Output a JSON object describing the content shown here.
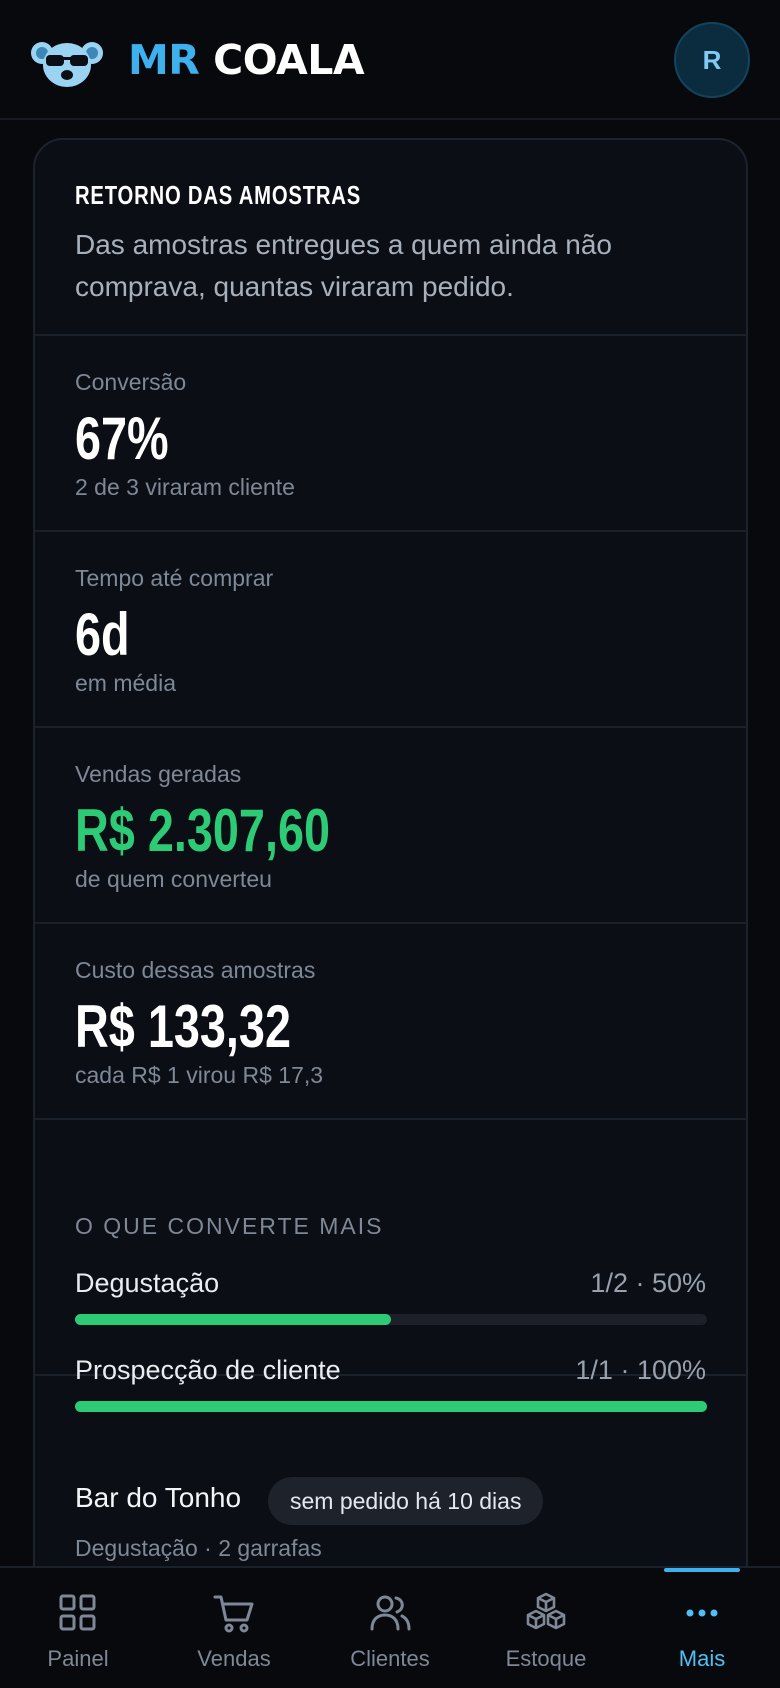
{
  "app": {
    "brand_mr": "MR",
    "brand_name": "COALA",
    "avatar_initial": "R"
  },
  "colors": {
    "accent": "#3fb0ee",
    "positive": "#2ecb77",
    "background": "#07090d",
    "card": "#0b0e14"
  },
  "card": {
    "title": "RETORNO DAS AMOSTRAS",
    "description": "Das amostras entregues a quem ainda não comprava, quantas viraram pedido.",
    "metrics": [
      {
        "label": "Conversão",
        "value": "67%",
        "sub": "2 de 3 viraram cliente"
      },
      {
        "label": "Tempo até comprar",
        "value": "6d",
        "sub": "em média"
      },
      {
        "label": "Vendas geradas",
        "value": "R$ 2.307,60",
        "sub": "de quem converteu"
      },
      {
        "label": "Custo dessas amostras",
        "value": "R$ 133,32",
        "sub": "cada R$ 1 virou R$ 17,3"
      }
    ],
    "conversion": {
      "title": "O QUE CONVERTE MAIS",
      "rows": [
        {
          "label": "Degustação",
          "value": "1/2 · 50%",
          "fraction": 0.5
        },
        {
          "label": "Prospecção de cliente",
          "value": "1/1 · 100%",
          "fraction": 1.0
        }
      ]
    },
    "item": {
      "name": "Bar do Tonho",
      "badge": "sem pedido há 10 dias",
      "sub": "Degustação · 2 garrafas"
    }
  },
  "tabs": [
    {
      "label": "Painel",
      "icon": "dashboard-icon"
    },
    {
      "label": "Vendas",
      "icon": "cart-icon"
    },
    {
      "label": "Clientes",
      "icon": "users-icon"
    },
    {
      "label": "Estoque",
      "icon": "boxes-icon"
    },
    {
      "label": "Mais",
      "icon": "more-icon",
      "active": true
    }
  ]
}
